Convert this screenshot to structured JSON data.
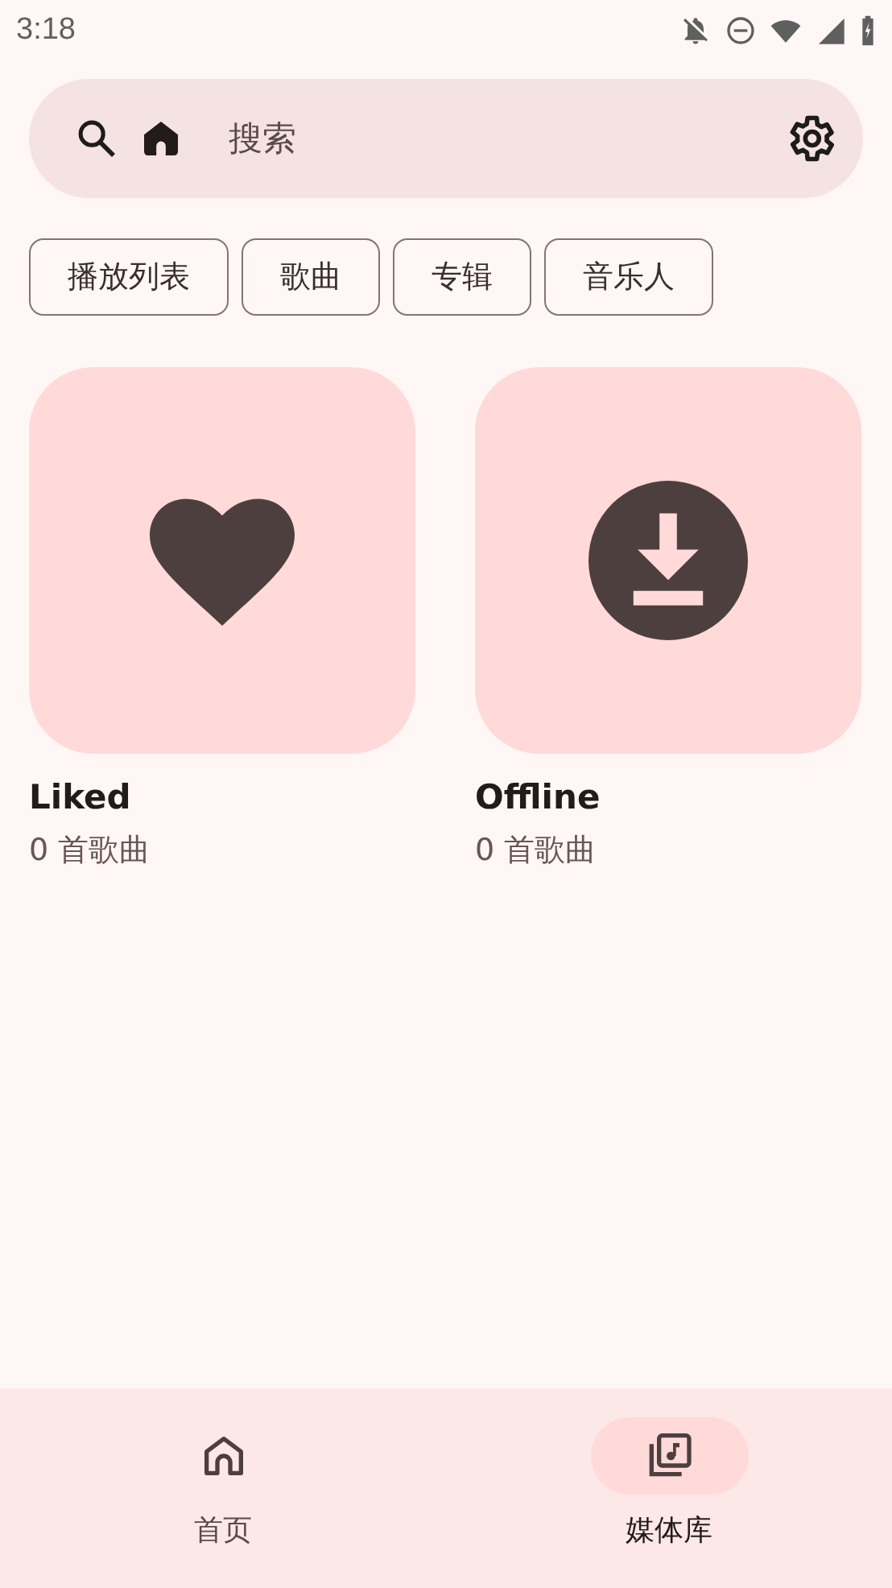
{
  "status_bar": {
    "time": "3:18"
  },
  "search": {
    "placeholder": "搜索"
  },
  "chips": [
    {
      "label": "播放列表",
      "selected": false
    },
    {
      "label": "歌曲",
      "selected": false
    },
    {
      "label": "专辑",
      "selected": false
    },
    {
      "label": "音乐人",
      "selected": false
    }
  ],
  "collections": [
    {
      "kind": "liked",
      "title": "Liked",
      "subtitle": "0 首歌曲"
    },
    {
      "kind": "offline",
      "title": "Offline",
      "subtitle": "0 首歌曲"
    }
  ],
  "nav": [
    {
      "kind": "home",
      "label": "首页",
      "selected": false
    },
    {
      "kind": "library",
      "label": "媒体库",
      "selected": true
    }
  ]
}
